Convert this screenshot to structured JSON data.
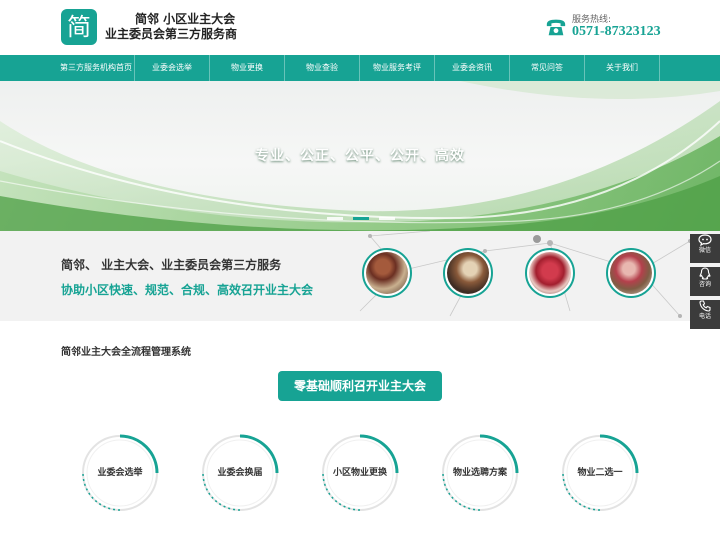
{
  "header": {
    "logo_glyph": "简",
    "title_line1": "简邻  小区业主大会",
    "title_line2": "业主委员会第三方服务商",
    "hotline_label": "服务热线:",
    "hotline_number": "0571-87323123"
  },
  "nav": {
    "items": [
      {
        "label": "第三方服务机构首页"
      },
      {
        "label": "业委会选举"
      },
      {
        "label": "物业更换"
      },
      {
        "label": "物业查验"
      },
      {
        "label": "物业服务考评"
      },
      {
        "label": "业委会资讯"
      },
      {
        "label": "常见问答"
      },
      {
        "label": "关于我们"
      }
    ]
  },
  "banner": {
    "slogan": "专业、公正、公平、公开、高效",
    "slides": 3,
    "active_slide": 2
  },
  "intro": {
    "line1": "简邻、 业主大会、业主委员会第三方服务",
    "line2": "协助小区快速、规范、合规、高效召开业主大会"
  },
  "sidebar": {
    "items": [
      {
        "label": "微信",
        "icon": "chat-bubble-icon"
      },
      {
        "label": "咨询",
        "icon": "qq-penguin-icon"
      },
      {
        "label": "电话",
        "icon": "phone-icon"
      }
    ]
  },
  "system": {
    "title": "简邻业主大会全流程管理系统",
    "cta_label": "零基础顺利召开业主大会",
    "services": [
      {
        "label": "业委会选举"
      },
      {
        "label": "业委会换届"
      },
      {
        "label": "小区物业更换"
      },
      {
        "label": "物业选聘方案"
      },
      {
        "label": "物业二选一"
      }
    ]
  },
  "colors": {
    "brand": "#17a394",
    "sidebar": "#3b3b3b",
    "intro_bg": "#f2f2f2"
  }
}
